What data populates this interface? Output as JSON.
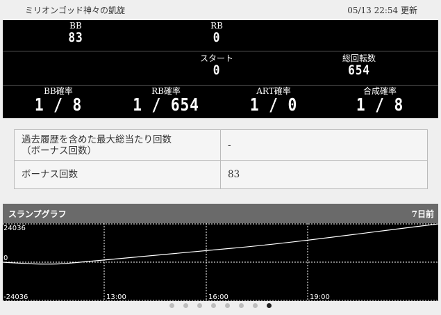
{
  "header": {
    "machine_name": "ミリオンゴッド神々の凱旋",
    "updated": "05/13 22:54 更新"
  },
  "counts": {
    "bb_label": "BB",
    "bb_value": "83",
    "rb_label": "RB",
    "rb_value": "0",
    "start_label": "スタート",
    "start_value": "0",
    "total_label": "総回転数",
    "total_value": "654"
  },
  "probabilities": {
    "bb_label": "BB確率",
    "bb_value": "1 / 8",
    "rb_label": "RB確率",
    "rb_value": "1 / 654",
    "art_label": "ART確率",
    "art_value": "1 / 0",
    "combined_label": "合成確率",
    "combined_value": "1 / 8"
  },
  "info_table": {
    "max_label_line1": "過去履歴を含めた最大総当たり回数",
    "max_label_line2": "（ボーナス回数）",
    "max_value": "-",
    "bonus_label": "ボーナス回数",
    "bonus_value": "83"
  },
  "graph": {
    "title": "スランプグラフ",
    "days_ago": "7日前",
    "y_top": "24036",
    "y_zero": "0",
    "y_bottom": "-24036",
    "x_labels": [
      "13:00",
      "16:00",
      "19:00"
    ],
    "line_color": "#ffffff",
    "grid_color": "#ffffff"
  },
  "pager": {
    "count": 8,
    "active_index": 7
  }
}
